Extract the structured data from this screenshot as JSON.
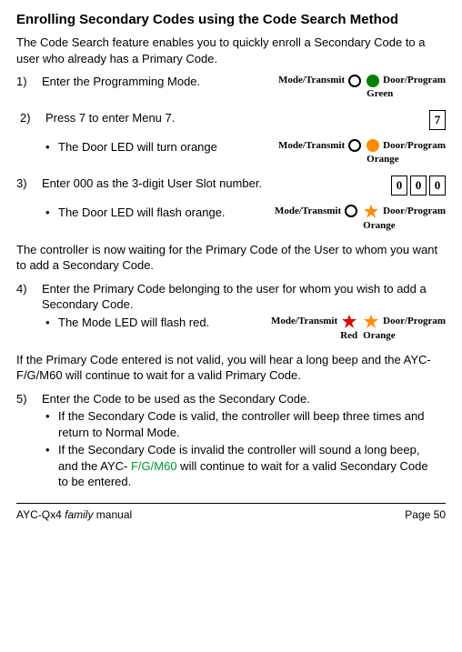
{
  "title": "Enrolling Secondary Codes using the Code Search Method",
  "intro": "The Code Search feature enables you to quickly enroll a Secondary Code to a user who already has a Primary Code.",
  "steps": {
    "s1": {
      "num": "1)",
      "text": "Enter the Programming Mode."
    },
    "s2": {
      "num": "2)",
      "text": "Press 7 to enter Menu 7."
    },
    "s2b": {
      "text": "The Door LED will turn orange"
    },
    "s3": {
      "num": "3)",
      "text": "Enter 000 as the 3-digit User Slot number."
    },
    "s3b": {
      "text": "The Door LED will flash orange."
    },
    "waiting": "The controller is now waiting for the Primary Code of the User to whom you want to add a Secondary Code.",
    "s4": {
      "num": "4)",
      "text": "Enter the Primary Code belonging to the user for whom you wish to add a Secondary Code."
    },
    "s4b": {
      "text": "The Mode LED will flash red."
    },
    "invalid": "If the Primary Code entered is not valid, you will hear a long beep and the AYC- F/G/M60 will continue to wait for a valid Primary Code.",
    "s5": {
      "num": "5)",
      "text": "Enter the Code to be used as the Secondary Code."
    },
    "s5b1": "If the Secondary Code is valid, the controller will beep three times and return to Normal Mode.",
    "s5b2_pre": "If the Secondary Code is invalid the controller will sound a long beep, and the AYC- ",
    "s5b2_mid": "F/G/M60",
    "s5b2_post": " will continue to wait for a valid Secondary Code to be entered."
  },
  "led": {
    "mode": "Mode/Transmit",
    "door": "Door/Program",
    "green": "Green",
    "orange": "Orange",
    "red": "Red"
  },
  "keys": {
    "k7": "7",
    "k0": "0"
  },
  "footer": {
    "left_prefix": "AYC-Qx4 ",
    "family": "family",
    "manual": " manual",
    "right": "Page 50"
  }
}
